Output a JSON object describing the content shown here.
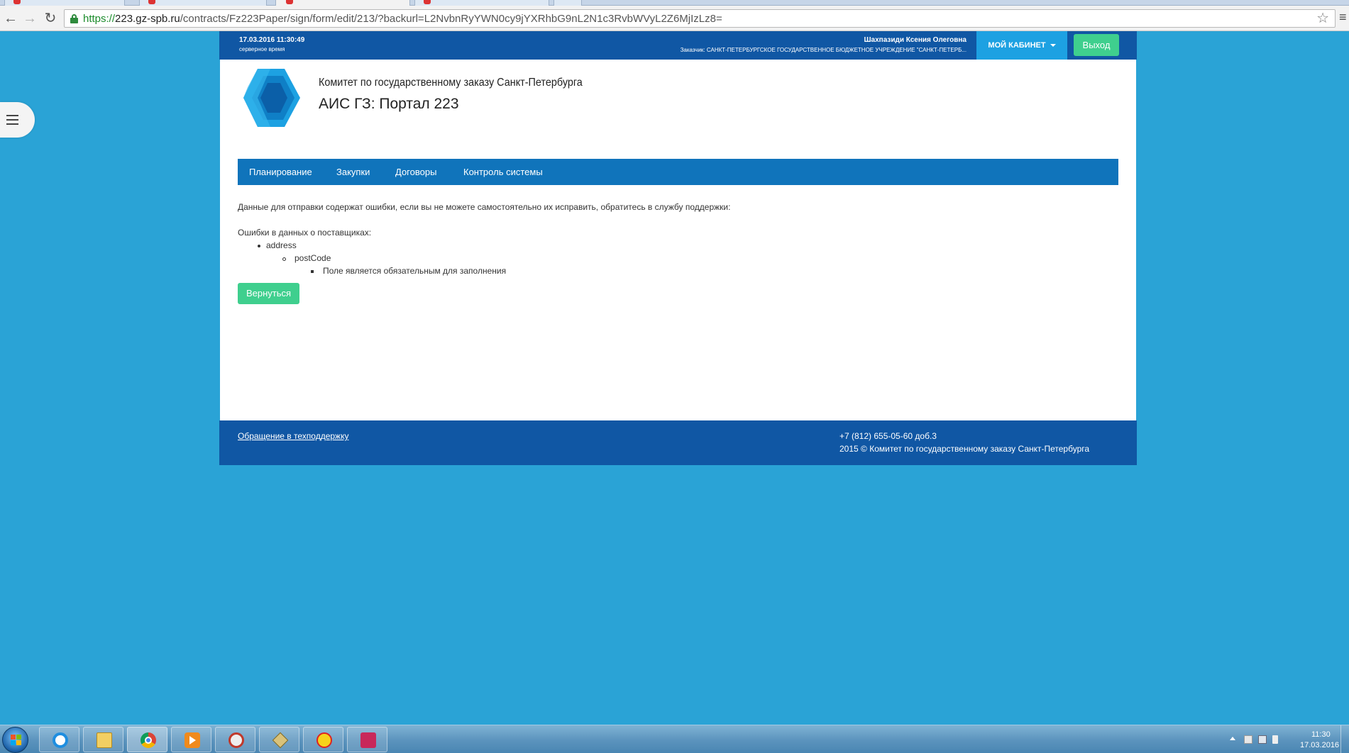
{
  "browser": {
    "url_scheme": "https://",
    "url_host": "223.gz-spb.ru",
    "url_path": "/contracts/Fz223Paper/sign/form/edit/213/?backurl=L2NvbnRyYWN0cy9jYXRhbG9nL2N1c3RvbWVyL2Z6MjIzLz8="
  },
  "topbar": {
    "server_time": "17.03.2016 11:30:49",
    "server_time_caption": "серверное время",
    "user_name": "Шахпазиди Ксения Олеговна",
    "customer": "Заказчик: САНКТ-ПЕТЕРБУРГСКОЕ ГОСУДАРСТВЕННОЕ БЮДЖЕТНОЕ УЧРЕЖДЕНИЕ \"САНКТ-ПЕТЕРБ...",
    "cabinet_label": "МОЙ КАБИНЕТ",
    "logout_label": "Выход"
  },
  "header": {
    "org_name": "Комитет по государственному заказу Санкт-Петербурга",
    "portal_name": "АИС ГЗ: Портал 223"
  },
  "nav": {
    "items": [
      "Планирование",
      "Закупки",
      "Договоры",
      "Контроль системы"
    ]
  },
  "main": {
    "message": "Данные для отправки содержат ошибки, если вы не можете самостоятельно их исправить, обратитесь в службу поддержки:",
    "errors_title": "Ошибки в данных о поставщиках:",
    "error_field": "address",
    "error_subfield": "postCode",
    "error_text": "Поле является обязательным для заполнения",
    "back_label": "Вернуться"
  },
  "footer": {
    "support_link": "Обращение в техподдержку",
    "phone": "+7 (812) 655-05-60 доб.3",
    "copyright": "2015 © Комитет по государственному заказу Санкт-Петербурга"
  },
  "taskbar": {
    "clock_time": "11:30",
    "clock_date": "17.03.2016",
    "apps": [
      "internet-explorer-icon",
      "file-explorer-icon",
      "chrome-icon",
      "media-player-icon",
      "tool-icon",
      "key-icon",
      "1c-icon",
      "app-icon"
    ]
  },
  "colors": {
    "page_bg": "#2aa3d6",
    "topbar": "#1057a4",
    "nav": "#1074bb",
    "accent_green": "#3fcf8e",
    "cabinet": "#1da1e2"
  }
}
